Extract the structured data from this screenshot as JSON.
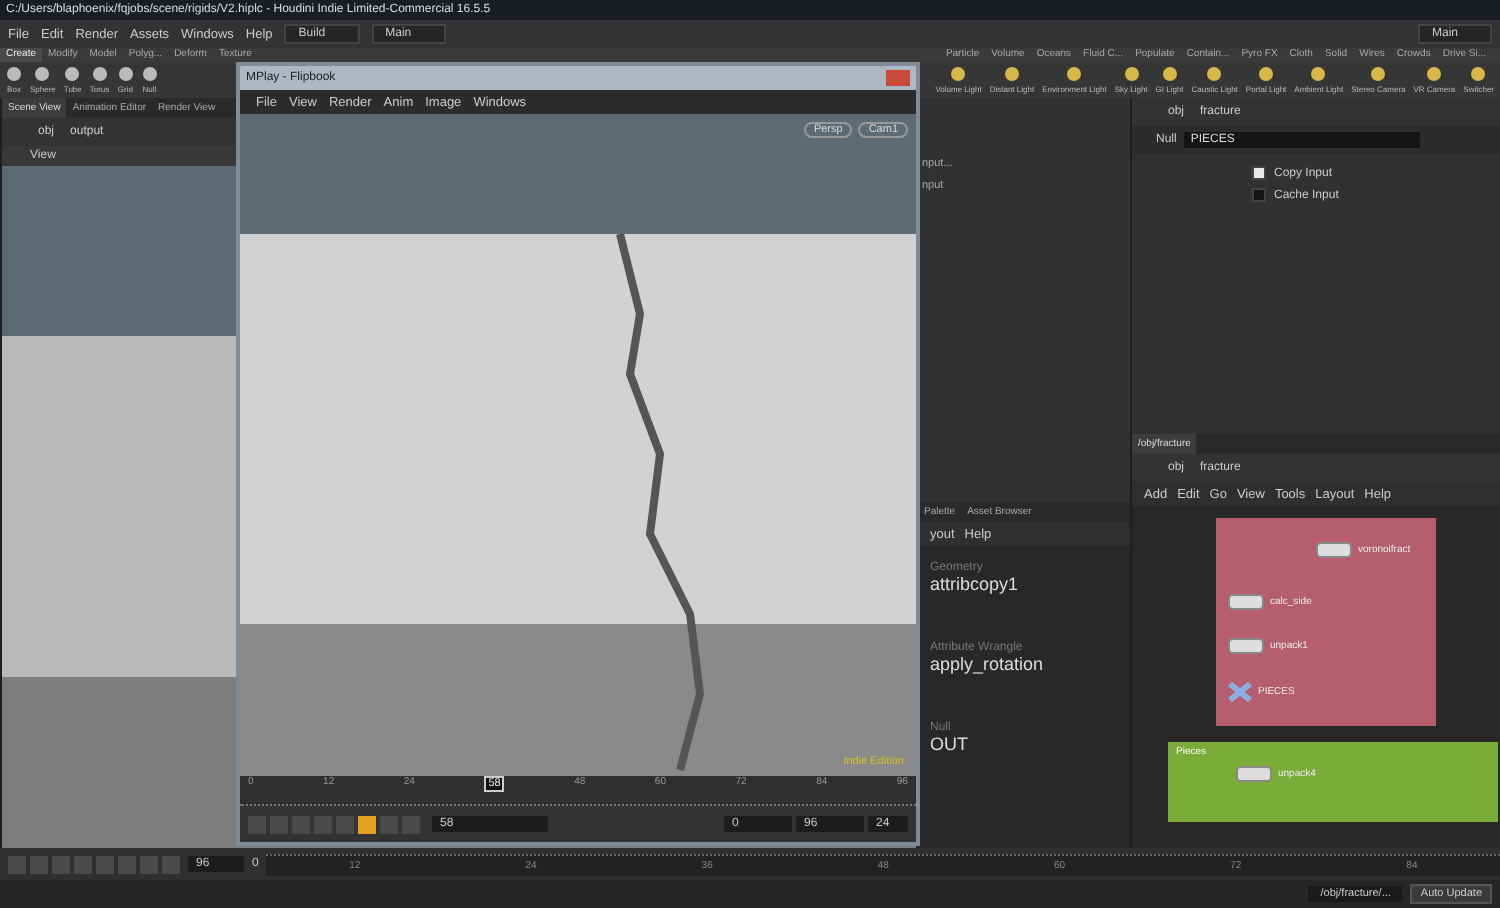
{
  "window": {
    "title": "C:/Users/blaphoenix/fqjobs/scene/rigids/V2.hiplc - Houdini Indie Limited-Commercial 16.5.5"
  },
  "menu": [
    "File",
    "Edit",
    "Render",
    "Assets",
    "Windows",
    "Help"
  ],
  "desktops": [
    "Build",
    "Main"
  ],
  "right_desktop": "Main",
  "shelf": {
    "tabs": [
      {
        "label": "Create",
        "selected": true
      },
      {
        "label": "Modify",
        "selected": false
      },
      {
        "label": "Model",
        "selected": false
      },
      {
        "label": "Polyg...",
        "selected": false
      },
      {
        "label": "Deform",
        "selected": false
      },
      {
        "label": "Texture",
        "selected": false
      },
      {
        "label": "Particle",
        "selected": false
      },
      {
        "label": "Volume",
        "selected": false
      },
      {
        "label": "Oceans",
        "selected": false
      },
      {
        "label": "Fluid C...",
        "selected": false
      },
      {
        "label": "Populate",
        "selected": false
      },
      {
        "label": "Contain...",
        "selected": false
      },
      {
        "label": "Pyro FX",
        "selected": false
      },
      {
        "label": "Cloth",
        "selected": false
      },
      {
        "label": "Solid",
        "selected": false
      },
      {
        "label": "Wires",
        "selected": false
      },
      {
        "label": "Crowds",
        "selected": false
      },
      {
        "label": "Drive Si...",
        "selected": false
      }
    ],
    "tools_left": [
      "Box",
      "Sphere",
      "Tube",
      "Torus",
      "Grid",
      "Null"
    ],
    "tools_right": [
      "Volume Light",
      "Distant Light",
      "Environment Light",
      "Sky Light",
      "GI Light",
      "Caustic Light",
      "Portal Light",
      "Ambient Light",
      "Stereo Camera",
      "VR Camera",
      "Switcher"
    ]
  },
  "scene_view": {
    "tabs": [
      {
        "label": "Scene View",
        "selected": true
      },
      {
        "label": "Animation Editor",
        "selected": false
      },
      {
        "label": "Render View",
        "selected": false
      }
    ],
    "path": [
      "obj",
      "output"
    ],
    "view_label": "View"
  },
  "mplay": {
    "title": "MPlay - Flipbook",
    "menu": [
      "File",
      "View",
      "Render",
      "Anim",
      "Image",
      "Windows"
    ],
    "camera": [
      "Persp",
      "Cam1"
    ],
    "stamp": "Indie Edition",
    "ticks": [
      "0",
      "12",
      "24",
      "48",
      "60",
      "72",
      "84",
      "96"
    ],
    "current": "58",
    "playing": true,
    "frame": "58",
    "range_start": "0",
    "range_end": "96",
    "fps": "24"
  },
  "middle": {
    "tabs": [
      "Palette",
      "Asset Browser"
    ],
    "menu": [
      "yout",
      "Help"
    ],
    "params": [
      "nput...",
      "nput"
    ],
    "nodes": [
      {
        "type": "Geometry",
        "name": "attribcopy1"
      },
      {
        "type": "Attribute Wrangle",
        "name": "apply_rotation"
      },
      {
        "type": "Null",
        "name": "OUT"
      }
    ]
  },
  "params": {
    "path": [
      "obj",
      "fracture"
    ],
    "node_type": "Null",
    "node_name": "PIECES",
    "options": [
      {
        "label": "Copy Input",
        "checked": true
      },
      {
        "label": "Cache Input",
        "checked": false
      }
    ]
  },
  "network": {
    "tab": "/obj/fracture",
    "path": [
      "obj",
      "fracture"
    ],
    "menu": [
      "Add",
      "Edit",
      "Go",
      "View",
      "Tools",
      "Layout",
      "Help"
    ],
    "nodes": [
      {
        "name": "voronoifract",
        "kind": "box"
      },
      {
        "name": "calc_side",
        "kind": "box"
      },
      {
        "name": "unpack1",
        "kind": "box"
      },
      {
        "name": "PIECES",
        "kind": "null"
      }
    ],
    "group": {
      "title": "Pieces",
      "node": "unpack4"
    }
  },
  "playbar": {
    "frame": "96",
    "start": "0",
    "ticks": [
      "12",
      "24",
      "36",
      "48",
      "60",
      "72",
      "84"
    ],
    "playing": false
  },
  "status": {
    "path": "/obj/fracture/...",
    "update": "Auto Update"
  }
}
